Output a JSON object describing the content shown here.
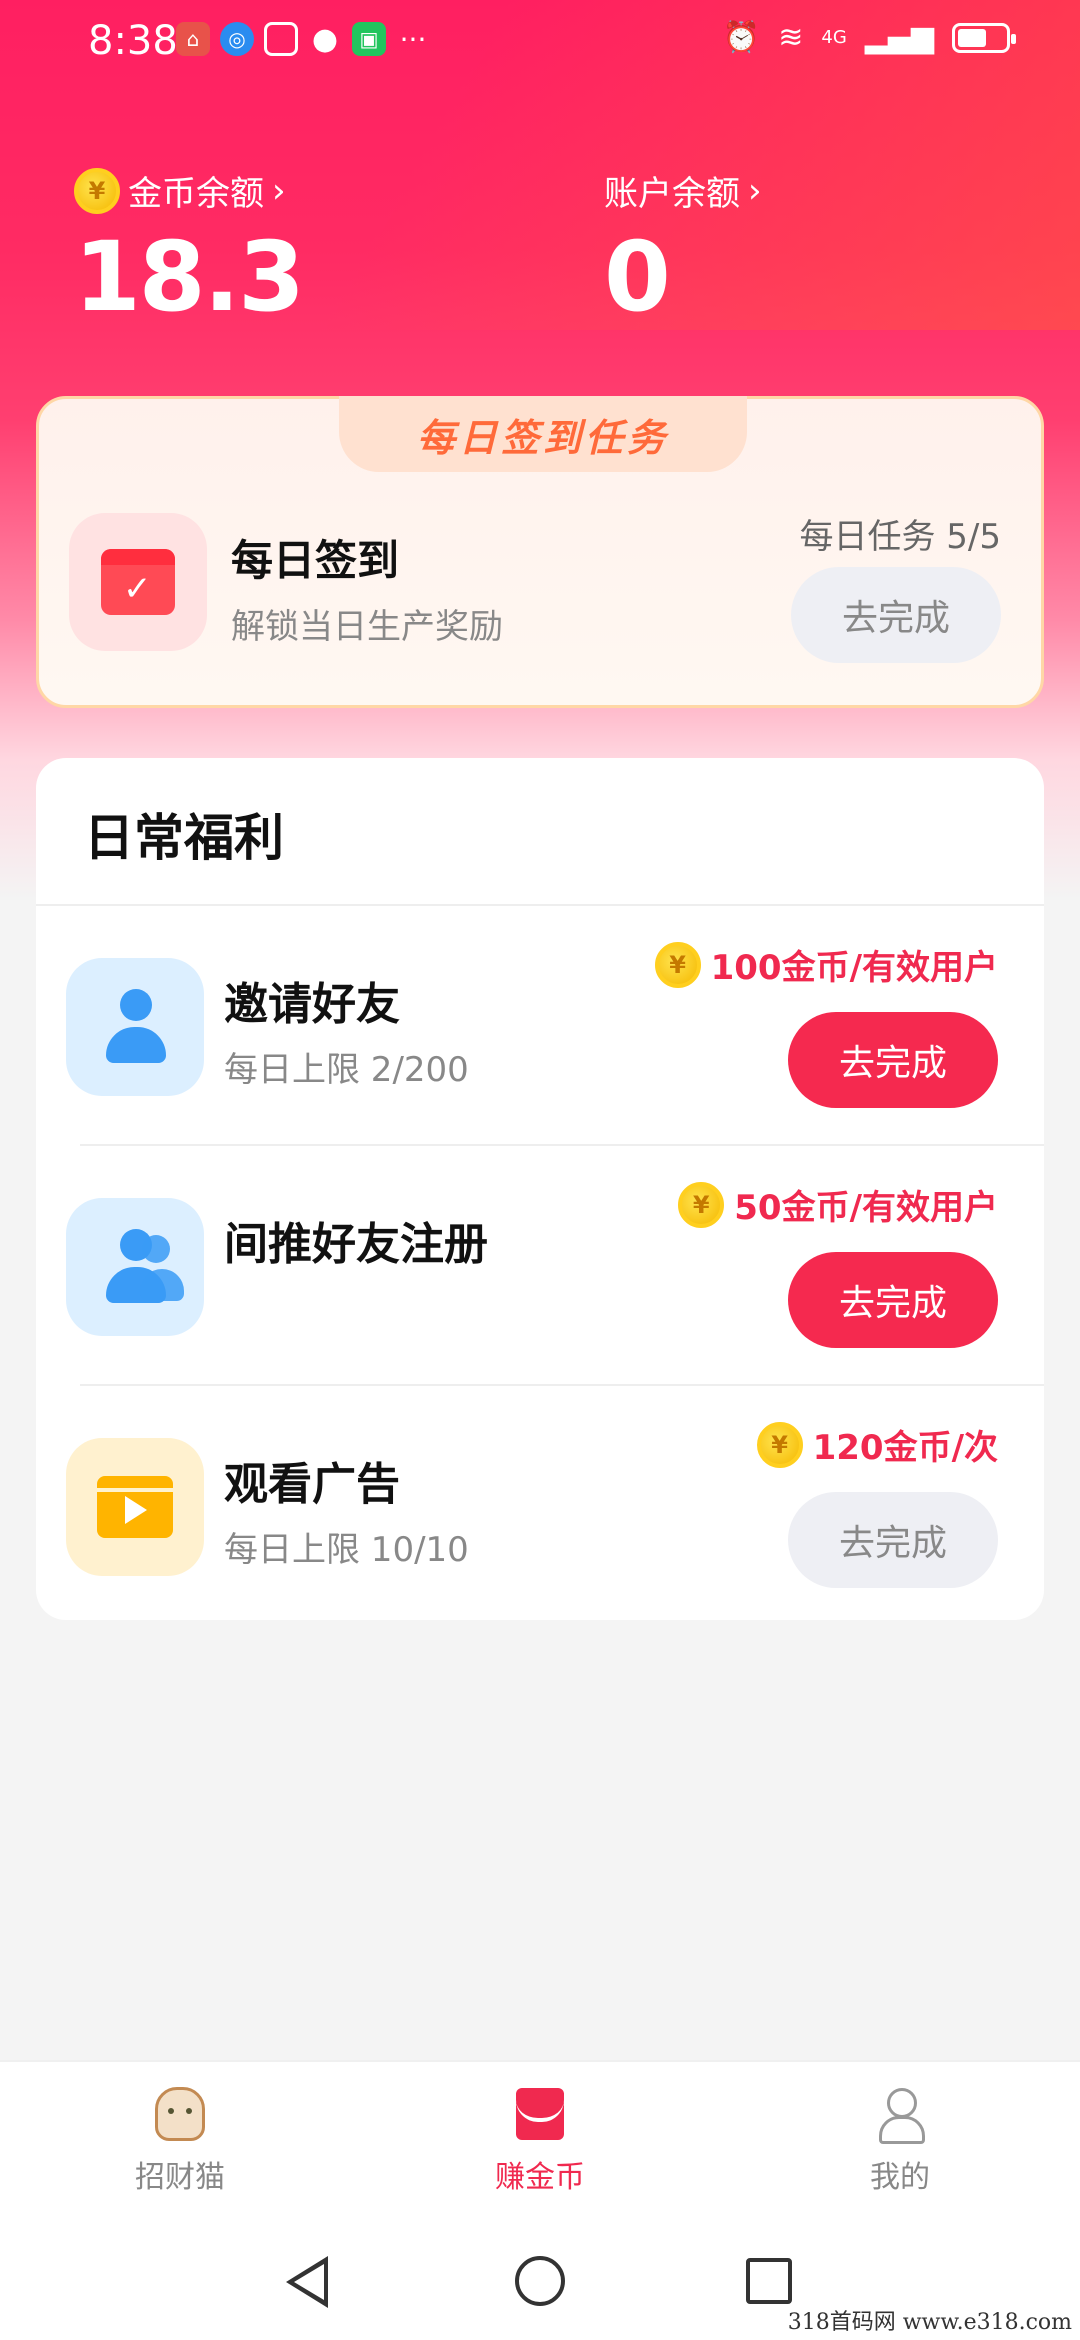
{
  "status_bar": {
    "time": "8:38",
    "network": "4G",
    "icons": [
      "huawei-app-icon",
      "browser-icon",
      "calendar-icon",
      "wechat-icon",
      "iqiyi-icon",
      "more-dots-icon",
      "alarm-icon",
      "wifi-icon",
      "signal-icon",
      "battery-icon"
    ],
    "more": "···"
  },
  "balances": {
    "coin_label": "金币余额",
    "coin_value": "18.3",
    "account_label": "账户余额",
    "account_value": "0",
    "coin_symbol": "¥"
  },
  "daily_signin": {
    "banner": "每日签到任务",
    "title": "每日签到",
    "subtitle": "解锁当日生产奖励",
    "progress": "每日任务 5/5",
    "button": "去完成"
  },
  "daily_welfare": {
    "title": "日常福利",
    "tasks": [
      {
        "title": "邀请好友",
        "subtitle": "每日上限 2/200",
        "reward": "100金币/有效用户",
        "button": "去完成",
        "button_state": "active"
      },
      {
        "title": "间推好友注册",
        "subtitle": "",
        "reward": "50金币/有效用户",
        "button": "去完成",
        "button_state": "active"
      },
      {
        "title": "观看广告",
        "subtitle": "每日上限 10/10",
        "reward": "120金币/次",
        "button": "去完成",
        "button_state": "disabled"
      }
    ]
  },
  "tabbar": {
    "items": [
      {
        "label": "招财猫",
        "icon": "lucky-cat-icon",
        "active": false
      },
      {
        "label": "赚金币",
        "icon": "red-envelope-icon",
        "active": true
      },
      {
        "label": "我的",
        "icon": "user-icon",
        "active": false
      }
    ]
  },
  "watermark": "318首码网  www.e318.com",
  "colors": {
    "primary": "#f0294f",
    "coin": "#ffcf1f",
    "disabled_button": "#eeeff4"
  }
}
